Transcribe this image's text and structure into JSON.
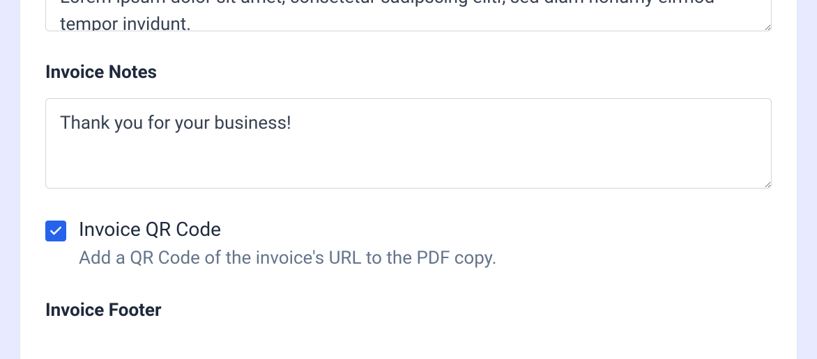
{
  "top_textarea": {
    "value": "Lorem ipsum dolor sit amet, consetetur sadipscing elitr, sed diam nonumy eirmod tempor invidunt."
  },
  "notes": {
    "label": "Invoice Notes",
    "value": "Thank you for your business!"
  },
  "qr_code": {
    "label": "Invoice QR Code",
    "description": "Add a QR Code of the invoice's URL to the PDF copy.",
    "checked": true
  },
  "footer": {
    "label": "Invoice Footer"
  }
}
